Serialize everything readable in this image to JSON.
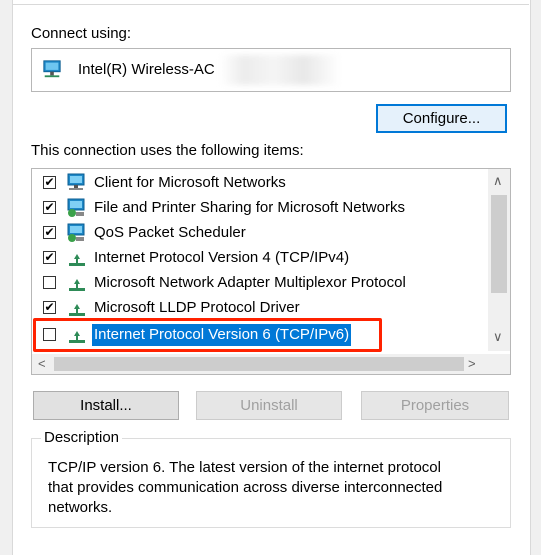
{
  "connect_using": {
    "label": "Connect using:",
    "adapter_name": "Intel(R) Wireless-AC",
    "configure_label": "Configure..."
  },
  "items_section": {
    "label": "This connection uses the following items:",
    "items": [
      {
        "label": "Client for Microsoft Networks",
        "checked": true,
        "icon": "network-client-icon"
      },
      {
        "label": "File and Printer Sharing for Microsoft Networks",
        "checked": true,
        "icon": "file-printer-sharing-icon"
      },
      {
        "label": "QoS Packet Scheduler",
        "checked": true,
        "icon": "qos-scheduler-icon"
      },
      {
        "label": "Internet Protocol Version 4 (TCP/IPv4)",
        "checked": true,
        "icon": "protocol-icon"
      },
      {
        "label": "Microsoft Network Adapter Multiplexor Protocol",
        "checked": false,
        "icon": "protocol-icon"
      },
      {
        "label": "Microsoft LLDP Protocol Driver",
        "checked": true,
        "icon": "protocol-icon"
      },
      {
        "label": "Internet Protocol Version 6 (TCP/IPv6)",
        "checked": false,
        "icon": "protocol-icon",
        "selected": true
      }
    ],
    "check_mark": "✔"
  },
  "buttons": {
    "install": "Install...",
    "uninstall": "Uninstall",
    "properties": "Properties"
  },
  "description": {
    "legend": "Description",
    "line1": "TCP/IP version 6. The latest version of the internet protocol",
    "line2": "that provides communication across diverse interconnected",
    "line3": "networks."
  },
  "colors": {
    "selection": "#0078d7",
    "highlight_box": "#ff2200",
    "protocol_icon": "#2e8b57"
  }
}
